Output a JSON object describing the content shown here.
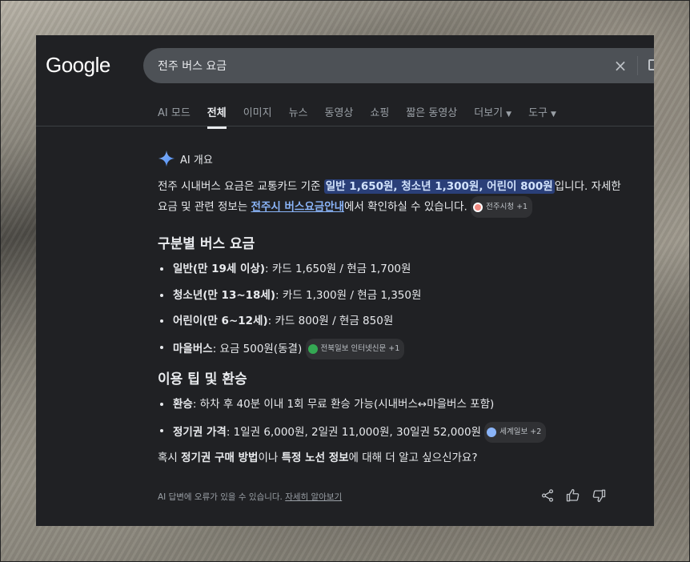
{
  "header": {
    "logo": "Google",
    "search_value": "전주 버스 요금",
    "clear_icon": "×"
  },
  "tabs": [
    {
      "label": "AI 모드",
      "active": false
    },
    {
      "label": "전체",
      "active": true
    },
    {
      "label": "이미지",
      "active": false
    },
    {
      "label": "뉴스",
      "active": false
    },
    {
      "label": "동영상",
      "active": false
    },
    {
      "label": "쇼핑",
      "active": false
    },
    {
      "label": "짧은 동영상",
      "active": false
    },
    {
      "label": "더보기",
      "active": false,
      "dropdown": true
    },
    {
      "label": "도구",
      "active": false,
      "dropdown": true
    }
  ],
  "ai_overview": {
    "title": "AI 개요",
    "intro_prefix": "전주 시내버스 요금은 교통카드 기준 ",
    "intro_highlight": "일반 1,650원, 청소년 1,300원, 어린이 800원",
    "intro_suffix": "입니다. 자세한 요금 및 관련 정보는 ",
    "intro_link": "전주시 버스요금안내",
    "intro_end": "에서 확인하실 수 있습니다.",
    "intro_chip": "전주시청 +1",
    "section1_title": "구분별 버스 요금",
    "section1_items": [
      {
        "bold": "일반(만 19세 이상)",
        "text": ": 카드 1,650원 / 현금 1,700원"
      },
      {
        "bold": "청소년(만 13~18세)",
        "text": ": 카드 1,300원 / 현금 1,350원"
      },
      {
        "bold": "어린이(만 6~12세)",
        "text": ": 카드 800원 / 현금 850원"
      },
      {
        "bold": "마을버스",
        "text": ": 요금 500원(동결)",
        "chip": "전북일보 인터넷신문 +1"
      }
    ],
    "section2_title": "이용 팁 및 환승",
    "section2_items": [
      {
        "bold": "환승",
        "text": ": 하차 후 40분 이내 1회 무료 환승 가능(시내버스↔마을버스 포함)"
      },
      {
        "bold": "정기권 가격",
        "text": ": 1일권 6,000원, 2일권 11,000원, 30일권 52,000원",
        "chip": "세계일보 +2"
      }
    ],
    "question_parts": [
      "혹시 ",
      "정기권 구매 방법",
      "이나 ",
      "특정 노선 정보",
      "에 대해 더 알고 싶으신가요?"
    ],
    "footer_note": "AI 답변에 오류가 있을 수 있습니다. ",
    "footer_link": "자세히 알아보기"
  },
  "colors": {
    "panel_bg": "#202124",
    "highlight_bg": "#2a3f78",
    "link": "#8ab4f8",
    "sparkle": "#4c8df6"
  }
}
